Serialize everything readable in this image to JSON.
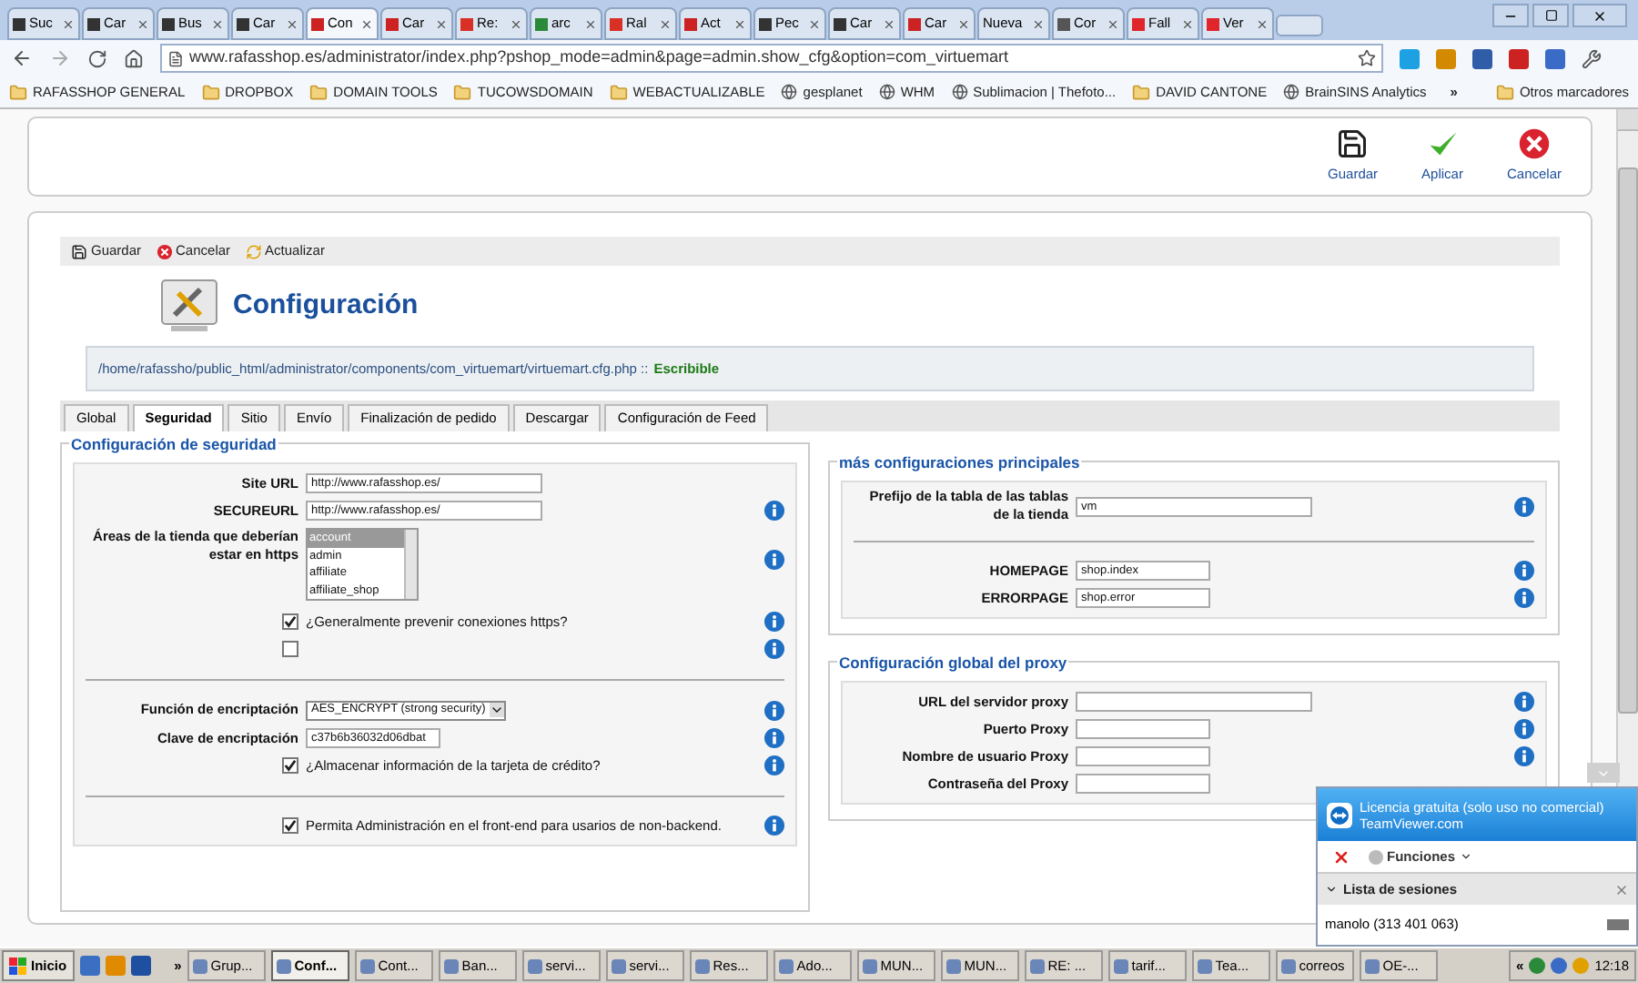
{
  "browser": {
    "tabs": [
      {
        "label": "Suc",
        "selected": false,
        "color": "#333333"
      },
      {
        "label": "Car",
        "selected": false,
        "color": "#333333"
      },
      {
        "label": "Bus",
        "selected": false,
        "color": "#333333"
      },
      {
        "label": "Car",
        "selected": false,
        "color": "#333333"
      },
      {
        "label": "Con",
        "selected": true,
        "color": "#cc2222"
      },
      {
        "label": "Car",
        "selected": false,
        "color": "#cc2222"
      },
      {
        "label": "Re:",
        "selected": false,
        "color": "#d93025"
      },
      {
        "label": "arc",
        "selected": false,
        "color": "#2a8a3a"
      },
      {
        "label": "Ral",
        "selected": false,
        "color": "#d93025"
      },
      {
        "label": "Act",
        "selected": false,
        "color": "#cc2222"
      },
      {
        "label": "Pec",
        "selected": false,
        "color": "#333333"
      },
      {
        "label": "Car",
        "selected": false,
        "color": "#333333"
      },
      {
        "label": "Car",
        "selected": false,
        "color": "#cc2222"
      },
      {
        "label": "Nueva",
        "selected": false
      },
      {
        "label": "Cor",
        "selected": false,
        "color": "#555555"
      },
      {
        "label": "Fall",
        "selected": false,
        "color": "#e0252b"
      },
      {
        "label": "Ver",
        "selected": false,
        "color": "#e0252b"
      }
    ],
    "address": "www.rafasshop.es/administrator/index.php?pshop_mode=admin&page=admin.show_cfg&option=com_virtuemart",
    "bookmarks": [
      {
        "label": "RAFASSHOP GENERAL",
        "kind": "folder"
      },
      {
        "label": "DROPBOX",
        "kind": "folder"
      },
      {
        "label": "DOMAIN TOOLS",
        "kind": "folder"
      },
      {
        "label": "TUCOWSDOMAIN",
        "kind": "folder"
      },
      {
        "label": "WEBACTUALIZABLE",
        "kind": "folder"
      },
      {
        "label": "gesplanet",
        "kind": "site"
      },
      {
        "label": "WHM",
        "kind": "site"
      },
      {
        "label": "Sublimacion | Thefoto...",
        "kind": "site"
      },
      {
        "label": "DAVID CANTONE",
        "kind": "folder"
      },
      {
        "label": "BrainSINS Analytics",
        "kind": "site"
      }
    ],
    "bookmarks_more": "»",
    "other_bookmarks": "Otros marcadores"
  },
  "toolbar": [
    {
      "label": "Guardar",
      "kind": "save"
    },
    {
      "label": "Aplicar",
      "kind": "apply"
    },
    {
      "label": "Cancelar",
      "kind": "cancel"
    }
  ],
  "subtoolbar": [
    {
      "label": "Guardar",
      "kind": "save"
    },
    {
      "label": "Cancelar",
      "kind": "cancel"
    },
    {
      "label": "Actualizar",
      "kind": "refresh"
    }
  ],
  "title": "Configuración",
  "config_path": {
    "path": "/home/rafassho/public_html/administrator/components/com_virtuemart/virtuemart.cfg.php ::",
    "status": "Escribible"
  },
  "tabs": [
    {
      "label": "Global",
      "selected": false
    },
    {
      "label": "Seguridad",
      "selected": true
    },
    {
      "label": "Sitio",
      "selected": false
    },
    {
      "label": "Envío",
      "selected": false
    },
    {
      "label": "Finalización de pedido",
      "selected": false
    },
    {
      "label": "Descargar",
      "selected": false
    },
    {
      "label": "Configuración de Feed",
      "selected": false
    }
  ],
  "security": {
    "legend": "Configuración de seguridad",
    "rows": [
      {
        "kind": "field",
        "label": "Site URL",
        "value": "http://www.rafasshop.es/",
        "info": false
      },
      {
        "kind": "field",
        "label": "SECUREURL",
        "value": "http://www.rafasshop.es/",
        "info": true
      },
      {
        "kind": "listbox",
        "label": "Áreas de la tienda que deberían estar en https",
        "options": [
          {
            "label": "account",
            "selected": true
          },
          {
            "label": "admin",
            "selected": false
          },
          {
            "label": "affiliate",
            "selected": false
          },
          {
            "label": "affiliate_shop",
            "selected": false
          }
        ],
        "info": true
      },
      {
        "kind": "checkbox",
        "label": "¿Generalmente prevenir conexiones https?",
        "checked": true,
        "info": true
      },
      {
        "kind": "checkbox",
        "checked": false,
        "info": true
      },
      {
        "kind": "divider"
      },
      {
        "kind": "select",
        "label": "Función de encriptación",
        "value": "AES_ENCRYPT (strong security)",
        "info": true
      },
      {
        "kind": "short_field",
        "label": "Clave de encriptación",
        "value": "c37b6b36032d06dbat",
        "info": true
      },
      {
        "kind": "checkbox",
        "label": "¿Almacenar información de la tarjeta de crédito?",
        "checked": true,
        "info": true
      },
      {
        "kind": "divider"
      },
      {
        "kind": "checkbox",
        "label": "Permita Administración en el front-end para usarios de non-backend.",
        "checked": true,
        "info": true
      }
    ]
  },
  "main_settings": {
    "legend": "más configuraciones principales",
    "rows": [
      {
        "kind": "field",
        "label": "Prefijo de la tabla de las tablas de la tienda",
        "value": "vm",
        "info": true
      },
      {
        "kind": "divider"
      },
      {
        "kind": "short_field",
        "label": "HOMEPAGE",
        "value": "shop.index",
        "info": true
      },
      {
        "kind": "short_field",
        "label": "ERRORPAGE",
        "value": "shop.error",
        "info": true
      }
    ]
  },
  "proxy": {
    "legend": "Configuración global del proxy",
    "rows": [
      {
        "kind": "field",
        "label": "URL del servidor proxy",
        "info": true
      },
      {
        "kind": "short_field",
        "label": "Puerto Proxy",
        "info": true
      },
      {
        "kind": "short_field",
        "label": "Nombre de usuario Proxy",
        "info": true
      },
      {
        "kind": "short_field",
        "label": "Contraseña del Proxy",
        "info": false
      }
    ]
  },
  "teamviewer": {
    "license": "Licencia gratuita (solo uso no comercial)",
    "site": "TeamViewer.com",
    "functions": "Funciones",
    "sessions_title": "Lista de sesiones",
    "sessions": [
      "manolo (313 401 063)"
    ]
  },
  "taskbar": {
    "start": "Inicio",
    "more": "»",
    "items": [
      {
        "label": "Grup...",
        "selected": false
      },
      {
        "label": "Conf...",
        "selected": true
      },
      {
        "label": "Cont...",
        "selected": false
      },
      {
        "label": "Ban...",
        "selected": false
      },
      {
        "label": "servi...",
        "selected": false
      },
      {
        "label": "servi...",
        "selected": false
      },
      {
        "label": "Res...",
        "selected": false
      },
      {
        "label": "Ado...",
        "selected": false
      },
      {
        "label": "MUN...",
        "selected": false
      },
      {
        "label": "MUN...",
        "selected": false
      },
      {
        "label": "RE: ...",
        "selected": false
      },
      {
        "label": "tarif...",
        "selected": false
      },
      {
        "label": "Tea...",
        "selected": false
      },
      {
        "label": "correos",
        "selected": false
      },
      {
        "label": "OE-...",
        "selected": false
      }
    ],
    "tray_toggle": "«",
    "clock": "12:18"
  }
}
